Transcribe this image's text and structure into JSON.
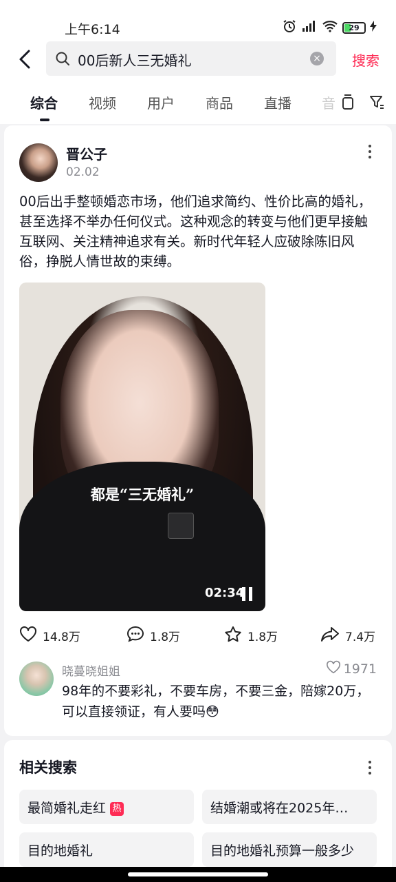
{
  "status_bar": {
    "time": "上午6:14",
    "battery": "29"
  },
  "search": {
    "query": "00后新人三无婚礼",
    "button_label": "搜索"
  },
  "tabs": [
    {
      "label": "综合",
      "active": true
    },
    {
      "label": "视频"
    },
    {
      "label": "用户"
    },
    {
      "label": "商品"
    },
    {
      "label": "直播"
    },
    {
      "label": "音"
    }
  ],
  "post": {
    "author": "晋公子",
    "date": "02.02",
    "caption": "00后出手整顿婚恋市场，他们追求简约、性价比高的婚礼，甚至选择不举办任何仪式。这种观念的转变与他们更早接触互联网、关注精神追求有关。新时代年轻人应破除陈旧风俗，挣脱人情世故的束缚。",
    "video": {
      "subtitle": "都是“三无婚礼”",
      "duration": "02:34"
    },
    "stats": {
      "likes": "14.8万",
      "comments": "1.8万",
      "favorites": "1.8万",
      "shares": "7.4万"
    },
    "top_comment": {
      "user": "晓蔓晓姐姐",
      "likes": "1971",
      "text": "98年的不要彩礼，不要车房，不要三金，陪嫁20万，可以直接领证，有人要吗😳"
    }
  },
  "related": {
    "title": "相关搜索",
    "hot_badge": "热",
    "items": [
      "最简婚礼走红",
      "结婚潮或将在2025年…",
      "目的地婚礼",
      "目的地婚礼预算一般多少"
    ]
  },
  "colors": {
    "accent": "#fe2c55",
    "text": "#161823",
    "muted": "#8a8b91"
  }
}
